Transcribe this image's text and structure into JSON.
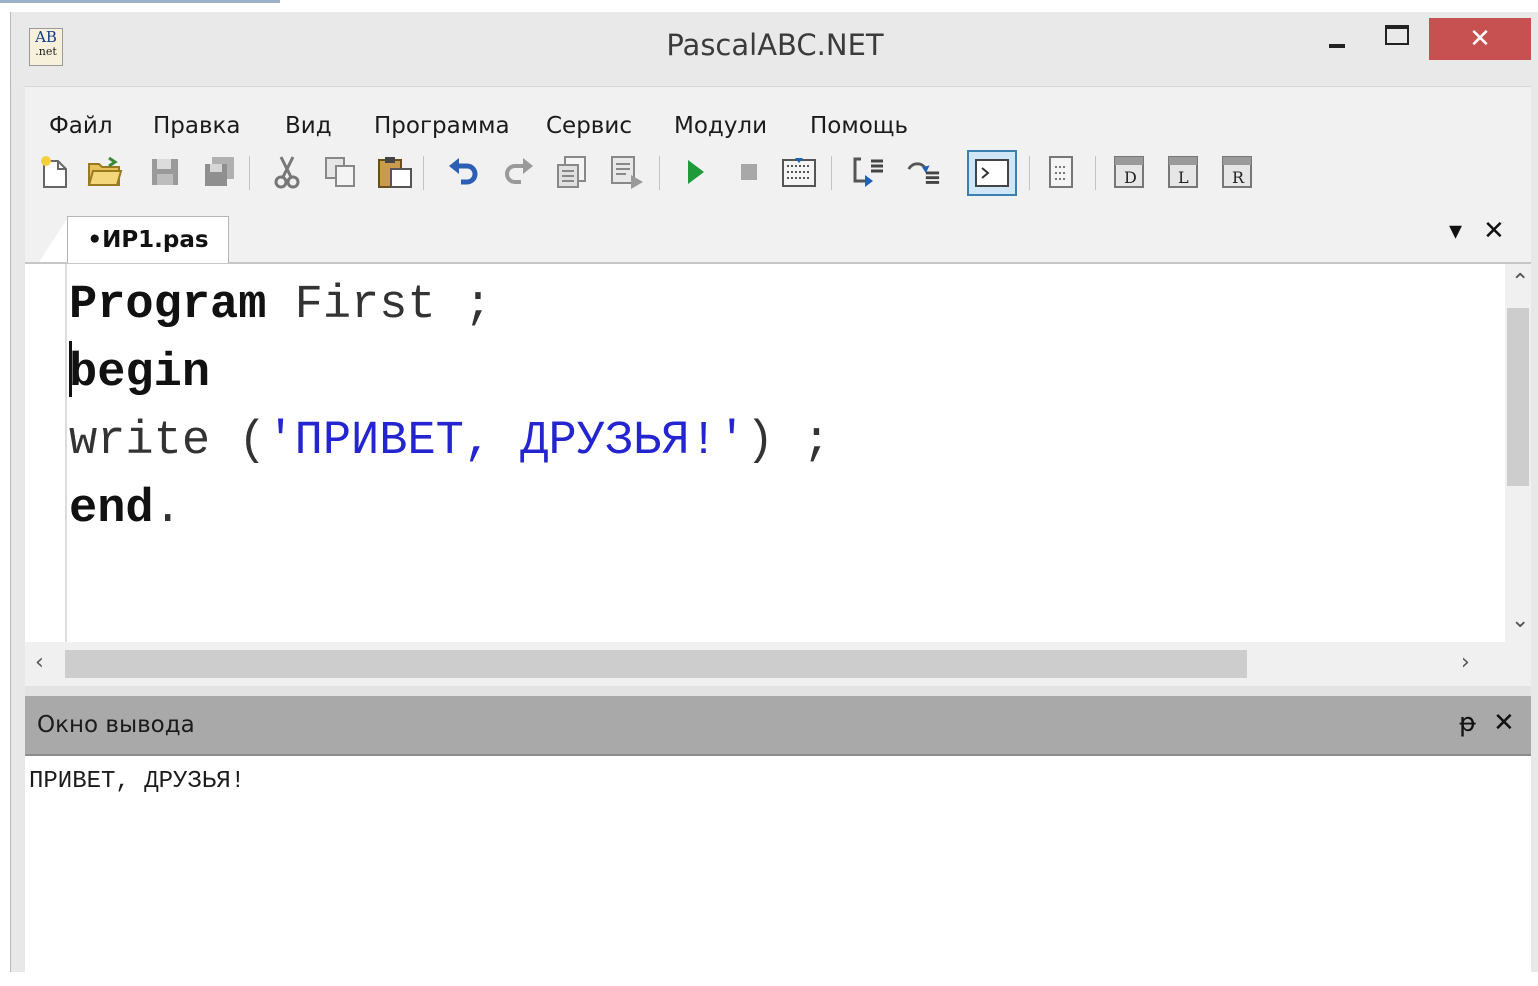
{
  "window": {
    "title": "PascalABC.NET",
    "icon_text_top": "AB",
    "icon_text_bottom": ".net",
    "close_glyph": "✕"
  },
  "menu": {
    "items": [
      "Файл",
      "Правка",
      "Вид",
      "Программа",
      "Сервис",
      "Модули",
      "Помощь"
    ]
  },
  "toolbar": {
    "buttons": [
      "new-file-icon",
      "open-folder-icon",
      "save-icon",
      "save-all-icon",
      "cut-icon",
      "copy-icon",
      "paste-icon",
      "undo-icon",
      "redo-icon",
      "find-icon",
      "replace-icon",
      "run-icon",
      "stop-icon",
      "compile-icon",
      "step-into-icon",
      "step-over-icon",
      "console-icon",
      "form-icon",
      "debug-d-icon",
      "debug-l-icon",
      "debug-r-icon"
    ],
    "selected": "console-icon"
  },
  "editor": {
    "tab_label": "•ИР1.pas",
    "tab_menu_glyph": "▾",
    "tab_close_glyph": "✕",
    "lines": [
      {
        "kw": "Program",
        "rest": " First ;"
      },
      {
        "kw": "begin",
        "rest": ""
      },
      {
        "plain": "write (",
        "str": "'ПРИВЕТ, ДРУЗЬЯ!'",
        "tail": ") ;"
      },
      {
        "kw": "end",
        "rest": "."
      }
    ]
  },
  "output": {
    "title": "Окно вывода",
    "pin_glyph": "ᵽ",
    "close_glyph": "✕",
    "text": "ПРИВЕТ, ДРУЗЬЯ!"
  },
  "colors": {
    "close_button": "#c75050",
    "string_literal": "#2424d0",
    "output_header": "#a9a9a9"
  }
}
